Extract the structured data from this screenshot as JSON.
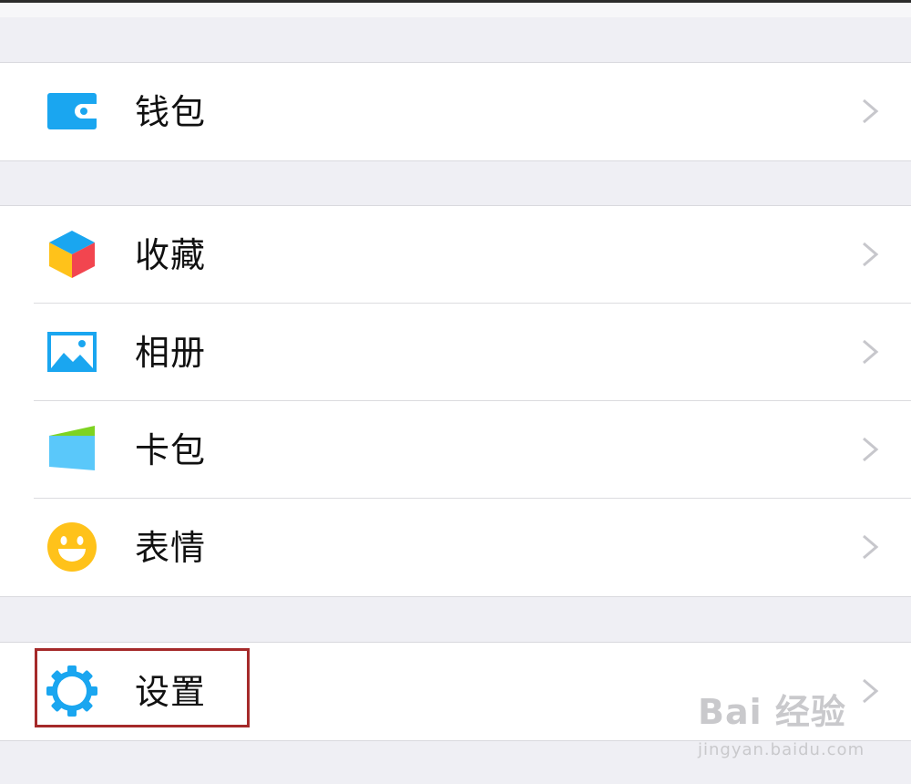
{
  "menu": {
    "group1": [
      {
        "label": "钱包",
        "icon": "wallet-icon"
      }
    ],
    "group2": [
      {
        "label": "收藏",
        "icon": "favorites-cube-icon"
      },
      {
        "label": "相册",
        "icon": "album-picture-icon"
      },
      {
        "label": "卡包",
        "icon": "card-pack-icon"
      },
      {
        "label": "表情",
        "icon": "smiley-emoji-icon"
      }
    ],
    "group3": [
      {
        "label": "设置",
        "icon": "gear-icon"
      }
    ]
  },
  "chevron_icon": "chevron-right-icon",
  "watermark": {
    "brand": "Bai 经验",
    "url": "jingyan.baidu.com"
  },
  "colors": {
    "background": "#efeff4",
    "row": "#ffffff",
    "icon_blue": "#1aa6f0",
    "highlight_border": "#a52a2a",
    "chevron": "#c7c7cc"
  }
}
